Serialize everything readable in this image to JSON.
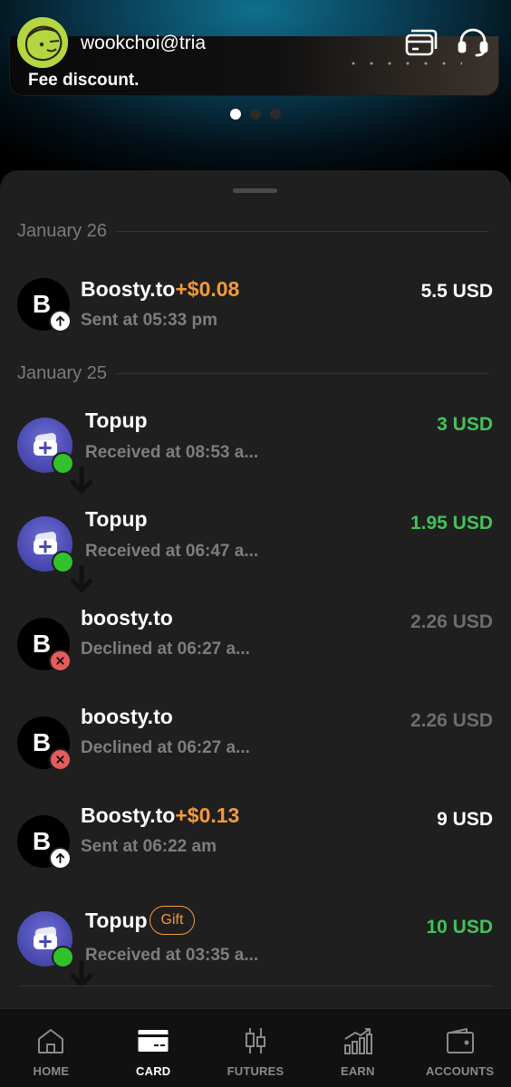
{
  "header": {
    "username": "wookchoi@tria",
    "banner_text": "Fee discount.",
    "carousel": {
      "count": 3,
      "active_index": 0
    },
    "icons": [
      "card-icon",
      "headset-icon"
    ]
  },
  "transactions": {
    "groups": [
      {
        "date": "January 26",
        "items": [
          {
            "merchant": "Boosty.to",
            "bonus": "+$0.08",
            "tag": "",
            "subtitle": "Sent at 05:33 pm",
            "amount": "5.5 USD",
            "status": "sent",
            "icon": "B"
          }
        ]
      },
      {
        "date": "January 25",
        "items": [
          {
            "merchant": "Topup",
            "bonus": "",
            "tag": "",
            "subtitle": "Received at 08:53 a...",
            "amount": "3 USD",
            "status": "received",
            "icon": "topup"
          },
          {
            "merchant": "Topup",
            "bonus": "",
            "tag": "",
            "subtitle": "Received at 06:47 a...",
            "amount": "1.95 USD",
            "status": "received",
            "icon": "topup"
          },
          {
            "merchant": "boosty.to",
            "bonus": "",
            "tag": "",
            "subtitle": "Declined at 06:27 a...",
            "amount": "2.26 USD",
            "status": "declined",
            "icon": "B"
          },
          {
            "merchant": "boosty.to",
            "bonus": "",
            "tag": "",
            "subtitle": "Declined at 06:27 a...",
            "amount": "2.26 USD",
            "status": "declined",
            "icon": "B"
          },
          {
            "merchant": "Boosty.to",
            "bonus": "+$0.13",
            "tag": "",
            "subtitle": "Sent at 06:22 am",
            "amount": "9 USD",
            "status": "sent",
            "icon": "B"
          },
          {
            "merchant": "Topup",
            "bonus": "",
            "tag": "Gift",
            "subtitle": "Received at 03:35 a...",
            "amount": "10 USD",
            "status": "received",
            "icon": "topup"
          }
        ]
      }
    ]
  },
  "nav": {
    "items": [
      {
        "label": "HOME",
        "icon": "home-icon",
        "active": false
      },
      {
        "label": "CARD",
        "icon": "card-icon",
        "active": true
      },
      {
        "label": "FUTURES",
        "icon": "candlestick-icon",
        "active": false
      },
      {
        "label": "EARN",
        "icon": "chart-growth-icon",
        "active": false
      },
      {
        "label": "ACCOUNTS",
        "icon": "wallet-icon",
        "active": false
      }
    ]
  },
  "colors": {
    "sheet_bg": "#1f1f1f",
    "bonus_orange": "#f39a3b",
    "received_green": "#44c25a",
    "declined_red": "#e65c5c",
    "avatar_lime": "#b5d640"
  }
}
